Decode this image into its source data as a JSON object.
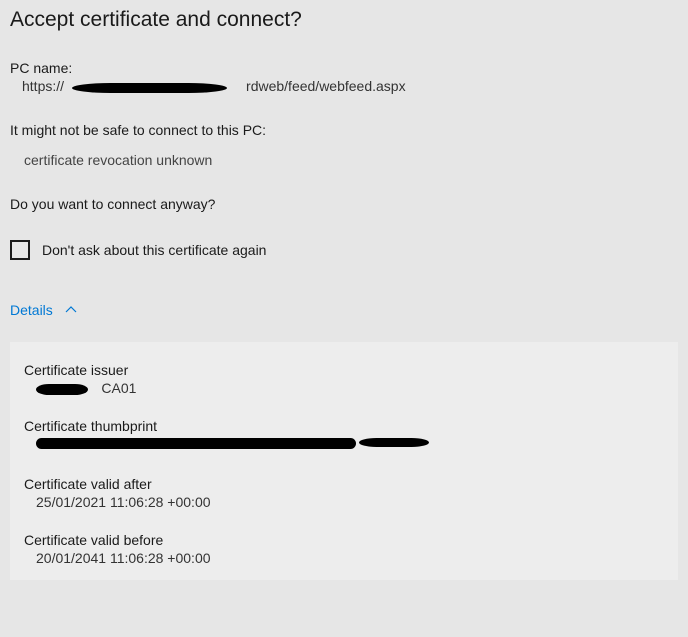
{
  "dialog": {
    "title": "Accept certificate and connect?",
    "pc_name_label": "PC name:",
    "pc_name_value_prefix": "https://",
    "pc_name_value_suffix": "rdweb/feed/webfeed.aspx",
    "warning_heading": "It might not be safe to connect to this PC:",
    "warning_detail": "certificate revocation unknown",
    "question": "Do you want to connect anyway?",
    "checkbox_label": "Don't ask about this certificate again",
    "details_label": "Details"
  },
  "certificate": {
    "issuer_label": "Certificate issuer",
    "issuer_value_suffix": "CA01",
    "thumbprint_label": "Certificate thumbprint",
    "valid_after_label": "Certificate valid after",
    "valid_after_value": "25/01/2021 11:06:28 +00:00",
    "valid_before_label": "Certificate valid before",
    "valid_before_value": "20/01/2041 11:06:28 +00:00"
  }
}
